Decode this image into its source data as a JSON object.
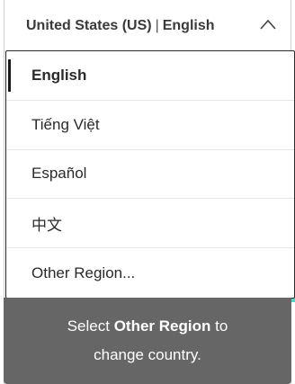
{
  "header": {
    "region": "United States (US)",
    "separator": "|",
    "language": "English",
    "chevron_icon": "chevron-up-icon"
  },
  "menu": {
    "items": [
      {
        "label": "English",
        "selected": true
      },
      {
        "label": "Tiếng Việt",
        "selected": false
      },
      {
        "label": "Español",
        "selected": false
      },
      {
        "label": "中文",
        "selected": false
      },
      {
        "label": "Other Region...",
        "selected": false
      }
    ]
  },
  "tooltip": {
    "prefix": "Select ",
    "highlight": "Other Region",
    "suffix": " to",
    "line2": "change country."
  },
  "colors": {
    "accent": "#57d1c6",
    "tooltip_bg": "#666666"
  }
}
